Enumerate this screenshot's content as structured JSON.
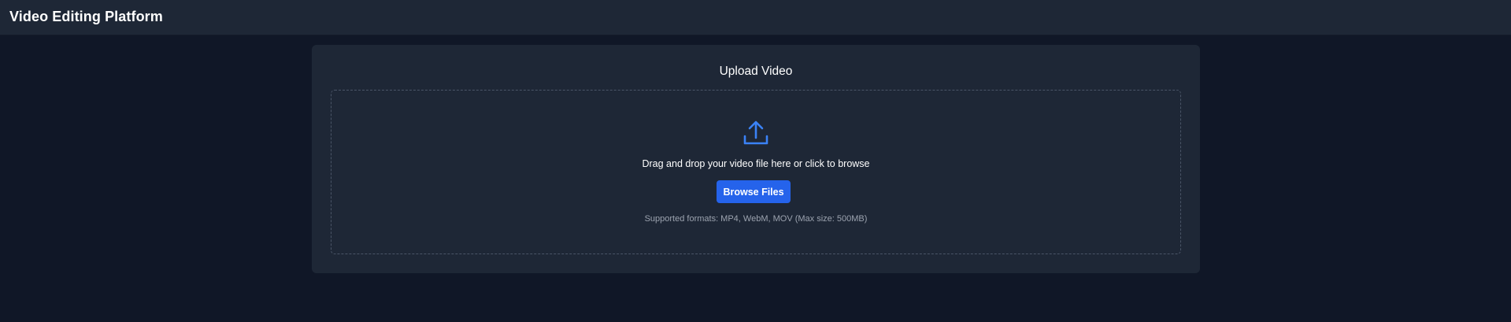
{
  "header": {
    "title": "Video Editing Platform"
  },
  "upload": {
    "title": "Upload Video",
    "drop_text": "Drag and drop your video file here or click to browse",
    "browse_label": "Browse Files",
    "formats_note": "Supported formats: MP4, WebM, MOV (Max size: 500MB)",
    "icon": "upload-icon"
  },
  "colors": {
    "page_background": "#101727",
    "panel_background": "#1e2736",
    "accent": "#2563eb",
    "icon": "#3b82f6",
    "muted_text": "#9ca3af",
    "dashed_border": "#4a5567"
  }
}
